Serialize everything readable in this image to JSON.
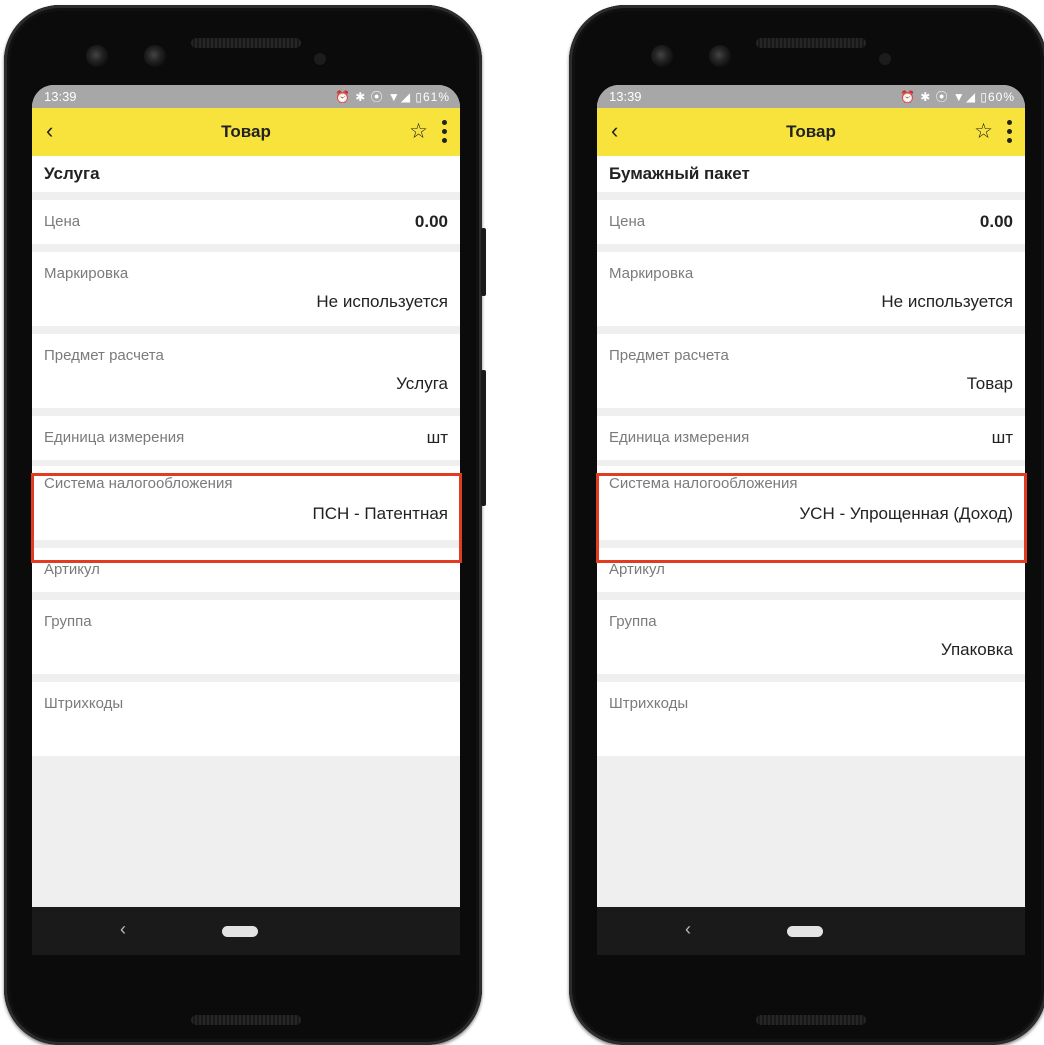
{
  "phones": [
    {
      "status": {
        "time": "13:39",
        "icons": "⏰ ✱ ⦿ ▼◢ ▯61%"
      },
      "toolbar": {
        "title": "Товар"
      },
      "item_title": "Услуга",
      "fields": {
        "price": {
          "label": "Цена",
          "value": "0.00"
        },
        "marking": {
          "label": "Маркировка",
          "value": "Не используется"
        },
        "subject": {
          "label": "Предмет расчета",
          "value": "Услуга"
        },
        "unit": {
          "label": "Единица измерения",
          "value": "шт"
        },
        "tax": {
          "label": "Система налогообложения",
          "value": "ПСН - Патентная"
        },
        "article": {
          "label": "Артикул",
          "value": ""
        },
        "group": {
          "label": "Группа",
          "value": ""
        },
        "barcodes": {
          "label": "Штрихкоды",
          "value": ""
        }
      }
    },
    {
      "status": {
        "time": "13:39",
        "icons": "⏰ ✱ ⦿ ▼◢ ▯60%"
      },
      "toolbar": {
        "title": "Товар"
      },
      "item_title": "Бумажный пакет",
      "fields": {
        "price": {
          "label": "Цена",
          "value": "0.00"
        },
        "marking": {
          "label": "Маркировка",
          "value": "Не используется"
        },
        "subject": {
          "label": "Предмет расчета",
          "value": "Товар"
        },
        "unit": {
          "label": "Единица измерения",
          "value": "шт"
        },
        "tax": {
          "label": "Система налогообложения",
          "value": "УСН - Упрощенная (Доход)"
        },
        "article": {
          "label": "Артикул",
          "value": ""
        },
        "group": {
          "label": "Группа",
          "value": "Упаковка"
        },
        "barcodes": {
          "label": "Штрихкоды",
          "value": ""
        }
      }
    }
  ],
  "colors": {
    "toolbar": "#f7e33c",
    "statusbar": "#a7a7a7",
    "highlight": "#e33a22"
  }
}
